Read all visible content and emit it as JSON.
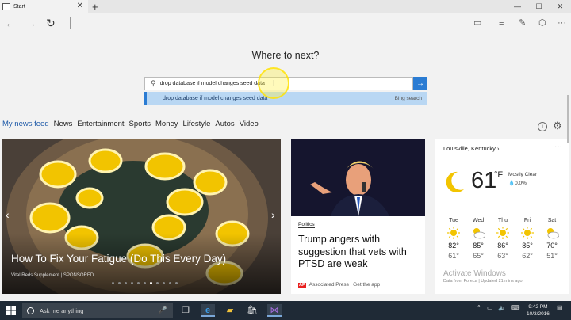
{
  "tab": {
    "title": "Start"
  },
  "window": {
    "minimize": "—",
    "maximize": "☐",
    "close": "✕"
  },
  "nav": {
    "back": "←",
    "forward": "→",
    "refresh": "↻"
  },
  "search": {
    "heading": "Where to next?",
    "value": "drop database if model changes seed data",
    "suggestion": "drop database if model changes seed data",
    "suggestion_source": "Bing search"
  },
  "news_nav": {
    "items": [
      "My news feed",
      "News",
      "Entertainment",
      "Sports",
      "Money",
      "Lifestyle",
      "Autos",
      "Video"
    ]
  },
  "hero": {
    "title": "How To Fix Your Fatigue (Do This Every Day)",
    "sponsor": "Vital Reds Supplement | SPONSORED",
    "slide_count": 11,
    "active_slide": 6
  },
  "story": {
    "category": "Politics",
    "title": "Trump angers with suggestion that vets with PTSD are weak",
    "source_logo": "AP",
    "source": "Associated Press | Get the app"
  },
  "weather": {
    "location": "Louisville, Kentucky",
    "more": "···",
    "temp": "61",
    "unit": "°F",
    "condition": "Mostly Clear",
    "precip": "0.0%",
    "days": [
      {
        "name": "Tue",
        "hi": "82°",
        "lo": "61°",
        "icon": "sun-icon"
      },
      {
        "name": "Wed",
        "hi": "85°",
        "lo": "65°",
        "icon": "partly-cloudy-icon"
      },
      {
        "name": "Thu",
        "hi": "86°",
        "lo": "63°",
        "icon": "sun-icon"
      },
      {
        "name": "Fri",
        "hi": "85°",
        "lo": "62°",
        "icon": "sun-icon"
      },
      {
        "name": "Sat",
        "hi": "70°",
        "lo": "51°",
        "icon": "partly-cloudy-icon"
      }
    ],
    "footer": "Data from Foreca | Updated 21 mins ago"
  },
  "watermark": "Activate Windows",
  "taskbar": {
    "search_placeholder": "Ask me anything",
    "time": "9:42 PM",
    "date": "10/3/2016"
  },
  "colors": {
    "accent": "#2b7cd3",
    "taskbar": "#1f2a36",
    "link": "#1e5aa8"
  }
}
